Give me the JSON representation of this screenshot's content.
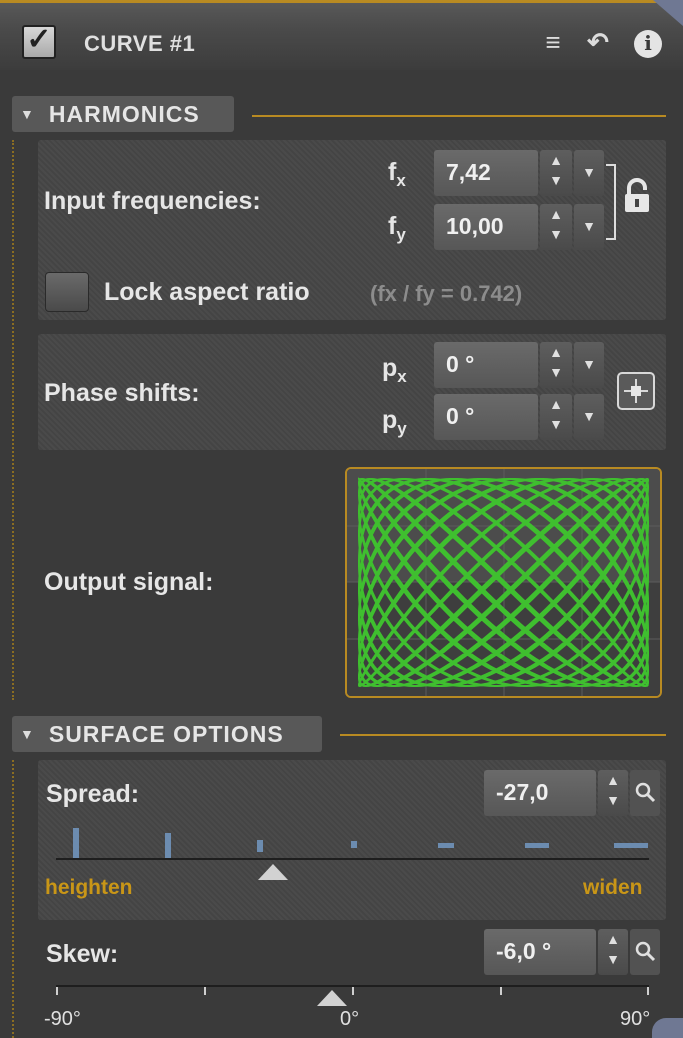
{
  "header": {
    "title": "CURVE #1",
    "enabled": true,
    "icons": [
      "menu-icon",
      "undo-icon",
      "info-icon"
    ]
  },
  "harmonics": {
    "section_label": "HARMONICS",
    "input_frequencies": {
      "label": "Input frequencies:",
      "fx_symbol": "f",
      "fx_sub": "x",
      "fx_value": "7,42",
      "fy_symbol": "f",
      "fy_sub": "y",
      "fy_value": "10,00"
    },
    "lock_aspect": {
      "label": "Lock aspect ratio",
      "hint": "(fx / fy = 0.742)",
      "checked": false
    },
    "phase_shifts": {
      "label": "Phase shifts:",
      "px_symbol": "p",
      "px_sub": "x",
      "px_value": "0 °",
      "py_symbol": "p",
      "py_sub": "y",
      "py_value": "0 °"
    },
    "output_signal": {
      "label": "Output signal:",
      "curve_fx": 7.42,
      "curve_fy": 10.0,
      "curve_color": "#3fbf2f"
    }
  },
  "surface_options": {
    "section_label": "SURFACE OPTIONS",
    "spread": {
      "label": "Spread:",
      "value": "-27,0",
      "left_label": "heighten",
      "right_label": "widen"
    },
    "skew": {
      "label": "Skew:",
      "value": "-6,0 °",
      "ticks": [
        "-90°",
        "0°",
        "90°"
      ]
    }
  },
  "colors": {
    "accent": "#b88a22",
    "label_orange": "#c99617",
    "curve_green": "#3fbf2f",
    "bar_blue": "#6c8cb0"
  }
}
